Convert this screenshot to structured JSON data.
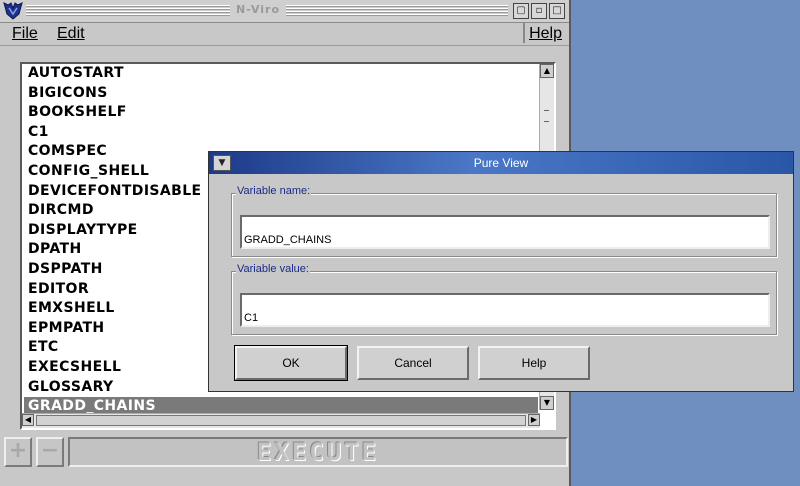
{
  "main_window": {
    "title": "N-Viro",
    "menu": {
      "file": "File",
      "edit": "Edit",
      "help": "Help"
    },
    "variables": [
      "AUTOSTART",
      "BIGICONS",
      "BOOKSHELF",
      "C1",
      "COMSPEC",
      "CONFIG_SHELL",
      "DEVICEFONTDISABLE",
      "DIRCMD",
      "DISPLAYTYPE",
      "DPATH",
      "DSPPATH",
      "EDITOR",
      "EMXSHELL",
      "EPMPATH",
      "ETC",
      "EXECSHELL",
      "GLOSSARY",
      "GRADD_CHAINS"
    ],
    "selected_variable": "GRADD_CHAINS",
    "execute_label": "EXECUTE"
  },
  "dialog": {
    "title": "Pure View",
    "name_label": "Variable name:",
    "name_value": "GRADD_CHAINS",
    "value_label": "Variable value:",
    "value_value": "C1",
    "ok": "OK",
    "cancel": "Cancel",
    "help": "Help"
  }
}
